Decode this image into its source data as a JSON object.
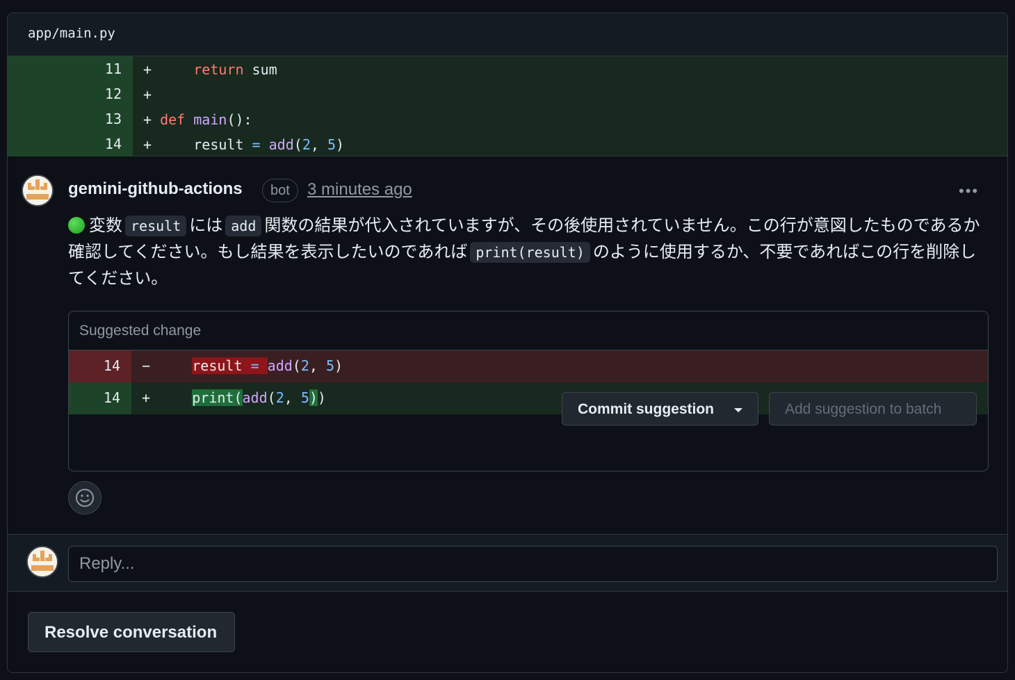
{
  "file": {
    "path": "app/main.py"
  },
  "diff": {
    "rows": [
      {
        "line": "11",
        "sign": "+"
      },
      {
        "line": "12",
        "sign": "+"
      },
      {
        "line": "13",
        "sign": "+"
      },
      {
        "line": "14",
        "sign": "+"
      }
    ]
  },
  "comment": {
    "author": "gemini-github-actions",
    "badge": "bot",
    "timestamp": "3 minutes ago",
    "more_icon": "kebab-horizontal-icon",
    "status_icon": "green-circle-icon",
    "body": {
      "t1": "変数",
      "c1": "result",
      "t2": "には",
      "c2": "add",
      "t3": "関数の結果が代入されていますが、その後使用されていません。この行が意図したものであるか確認してください。もし結果を表示したいのであれば",
      "c3": "print(result)",
      "t4": "のように使用するか、不要であればこの行を削除してください。"
    }
  },
  "suggestion": {
    "header": "Suggested change",
    "deleted": {
      "line": "14",
      "sign": "−"
    },
    "added": {
      "line": "14",
      "sign": "+"
    },
    "commit_label": "Commit suggestion",
    "batch_label": "Add suggestion to batch"
  },
  "reply": {
    "placeholder": "Reply..."
  },
  "resolve_label": "Resolve conversation",
  "colors": {
    "add_bg": "#18291f",
    "del_bg": "#3a1f22",
    "keyword": "#ff7b72",
    "function": "#d2a8ff",
    "number": "#79c0ff"
  }
}
